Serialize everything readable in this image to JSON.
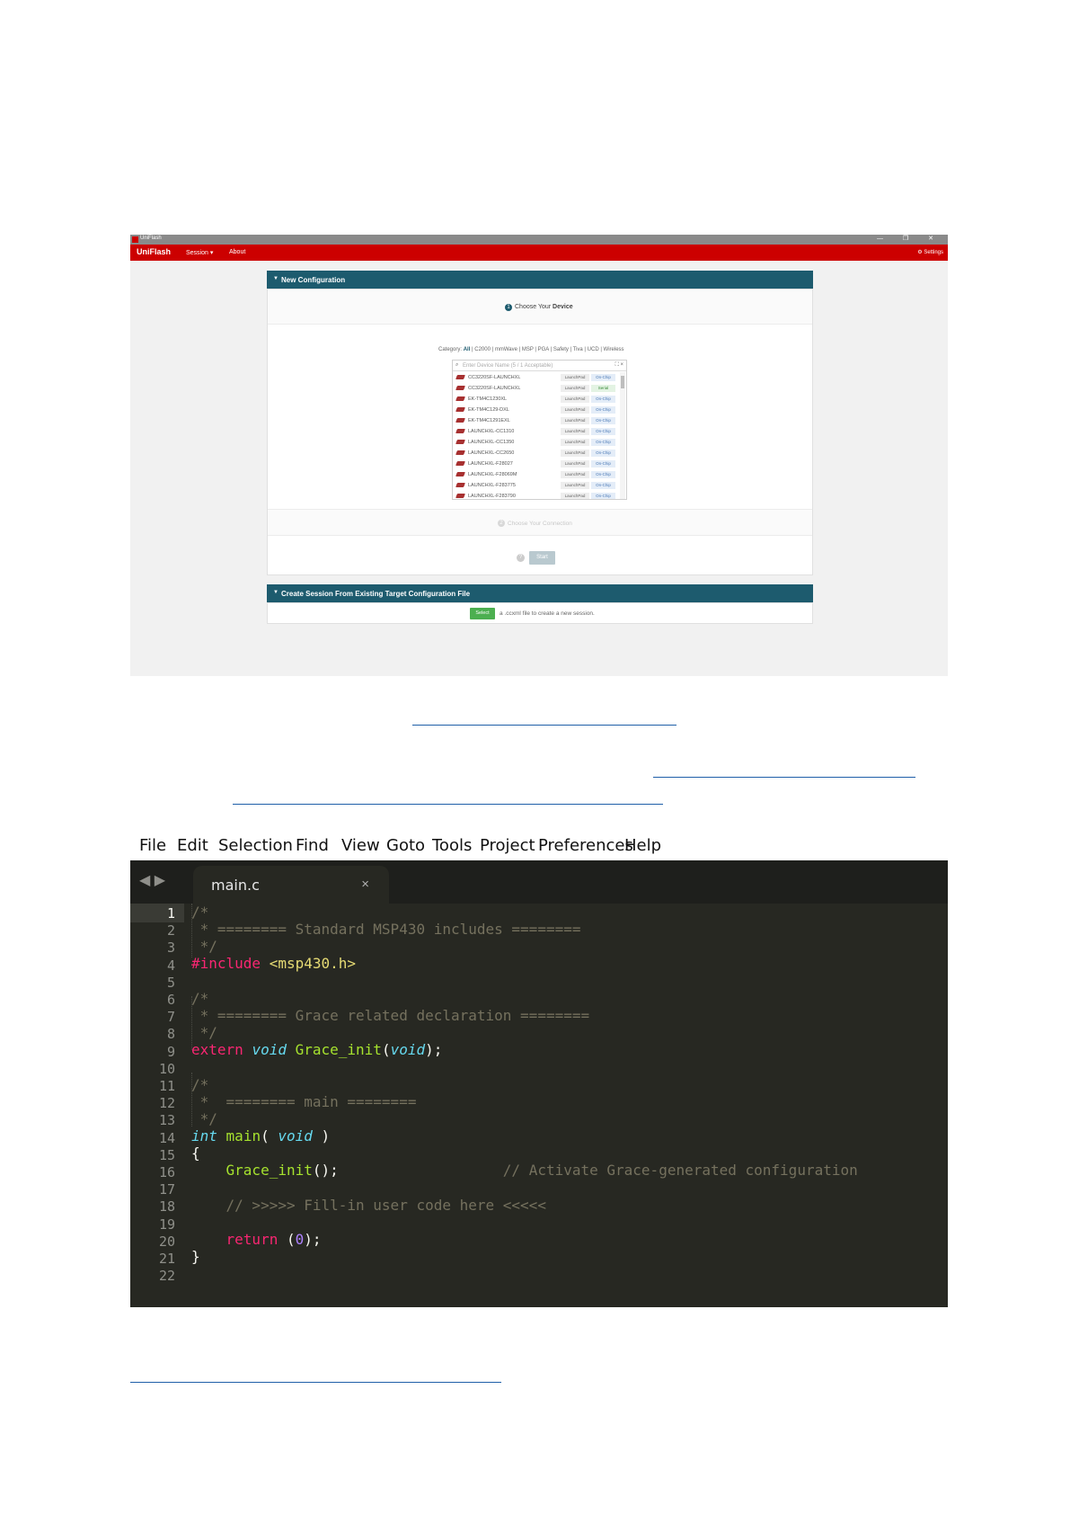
{
  "uniflash": {
    "window_title": "UniFlash",
    "window_controls": "— ❐ ✕",
    "brand": "UniFlash",
    "menu_session": "Session ▾",
    "menu_about": "About",
    "settings": "Settings",
    "section_new_config": "New Configuration",
    "step1_number": "1",
    "step1_prefix": "Choose Your ",
    "step1_bold": "Device",
    "category_label": "Category:",
    "category_all": "All",
    "category_rest": "| C2000 | mmWave | MSP | PGA | Safety | Tiva | UCD | Wireless",
    "search_placeholder": "Enter Device Name (5 / 1 Acceptable)",
    "devices": [
      {
        "name": "CC3220SF-LAUNCHXL",
        "tag1": "LaunchPad",
        "tag2": "On-Chip"
      },
      {
        "name": "CC3220SF-LAUNCHXL",
        "tag1": "LaunchPad",
        "tag2": "Serial"
      },
      {
        "name": "EK-TM4C1230XL",
        "tag1": "LaunchPad",
        "tag2": "On-Chip"
      },
      {
        "name": "EK-TM4C129-DXL",
        "tag1": "LaunchPad",
        "tag2": "On-Chip"
      },
      {
        "name": "EK-TM4C1291EXL",
        "tag1": "LaunchPad",
        "tag2": "On-Chip"
      },
      {
        "name": "LAUNCHXL-CC1310",
        "tag1": "LaunchPad",
        "tag2": "On-Chip"
      },
      {
        "name": "LAUNCHXL-CC1350",
        "tag1": "LaunchPad",
        "tag2": "On-Chip"
      },
      {
        "name": "LAUNCHXL-CC2650",
        "tag1": "LaunchPad",
        "tag2": "On-Chip"
      },
      {
        "name": "LAUNCHXL-F28027",
        "tag1": "LaunchPad",
        "tag2": "On-Chip"
      },
      {
        "name": "LAUNCHXL-F28069M",
        "tag1": "LaunchPad",
        "tag2": "On-Chip"
      },
      {
        "name": "LAUNCHXL-F283775",
        "tag1": "LaunchPad",
        "tag2": "On-Chip"
      },
      {
        "name": "LAUNCHXL-F283790",
        "tag1": "LaunchPad",
        "tag2": "On-Chip"
      }
    ],
    "step2_number": "2",
    "step2_label": "Choose Your Connection",
    "help_glyph": "?",
    "start_label": "Start",
    "section_existing": "Create Session From Existing Target Configuration File",
    "select_label": "Select",
    "select_hint": "a .ccxml file to create a new session."
  },
  "editor": {
    "menu": [
      "File",
      "Edit",
      "Selection",
      "Find",
      "View",
      "Goto",
      "Tools",
      "Project",
      "Preferences",
      "Help"
    ],
    "nav_arrows": "◀ ▶",
    "tab_name": "main.c",
    "tab_close": "×",
    "line_numbers": [
      "1",
      "2",
      "3",
      "4",
      "5",
      "6",
      "7",
      "8",
      "9",
      "10",
      "11",
      "12",
      "13",
      "14",
      "15",
      "16",
      "17",
      "18",
      "19",
      "20",
      "21",
      "22"
    ],
    "lines": {
      "l1": "/*",
      "l2": " * ======== Standard MSP430 includes ========",
      "l3": " */",
      "l4_pre": "#include",
      "l4_hdr": " <msp430.h>",
      "l6": "/*",
      "l7": " * ======== Grace related declaration ========",
      "l8": " */",
      "l9_kw": "extern",
      "l9_void": "void",
      "l9_fn": "Grace_init",
      "l9_open": "(",
      "l9_void2": "void",
      "l9_close": ");",
      "l11": "/*",
      "l12": " *  ======== main ========",
      "l13": " */",
      "l14_int": "int",
      "l14_fn": "main",
      "l14_open": "( ",
      "l14_void": "void",
      "l14_close": " )",
      "l15": "{",
      "l16_fn": "Grace_init",
      "l16_call": "();",
      "l16_comment": "// Activate Grace-generated configuration",
      "l18": "// >>>>> Fill-in user code here <<<<<",
      "l20_kw": "return",
      "l20_open": " (",
      "l20_num": "0",
      "l20_close": ");",
      "l21": "}"
    }
  },
  "colors": {
    "uniflash_red": "#cc0000",
    "uniflash_teal": "#1d5b6e",
    "editor_bg": "#272822",
    "link_blue": "#1f5fa8"
  }
}
